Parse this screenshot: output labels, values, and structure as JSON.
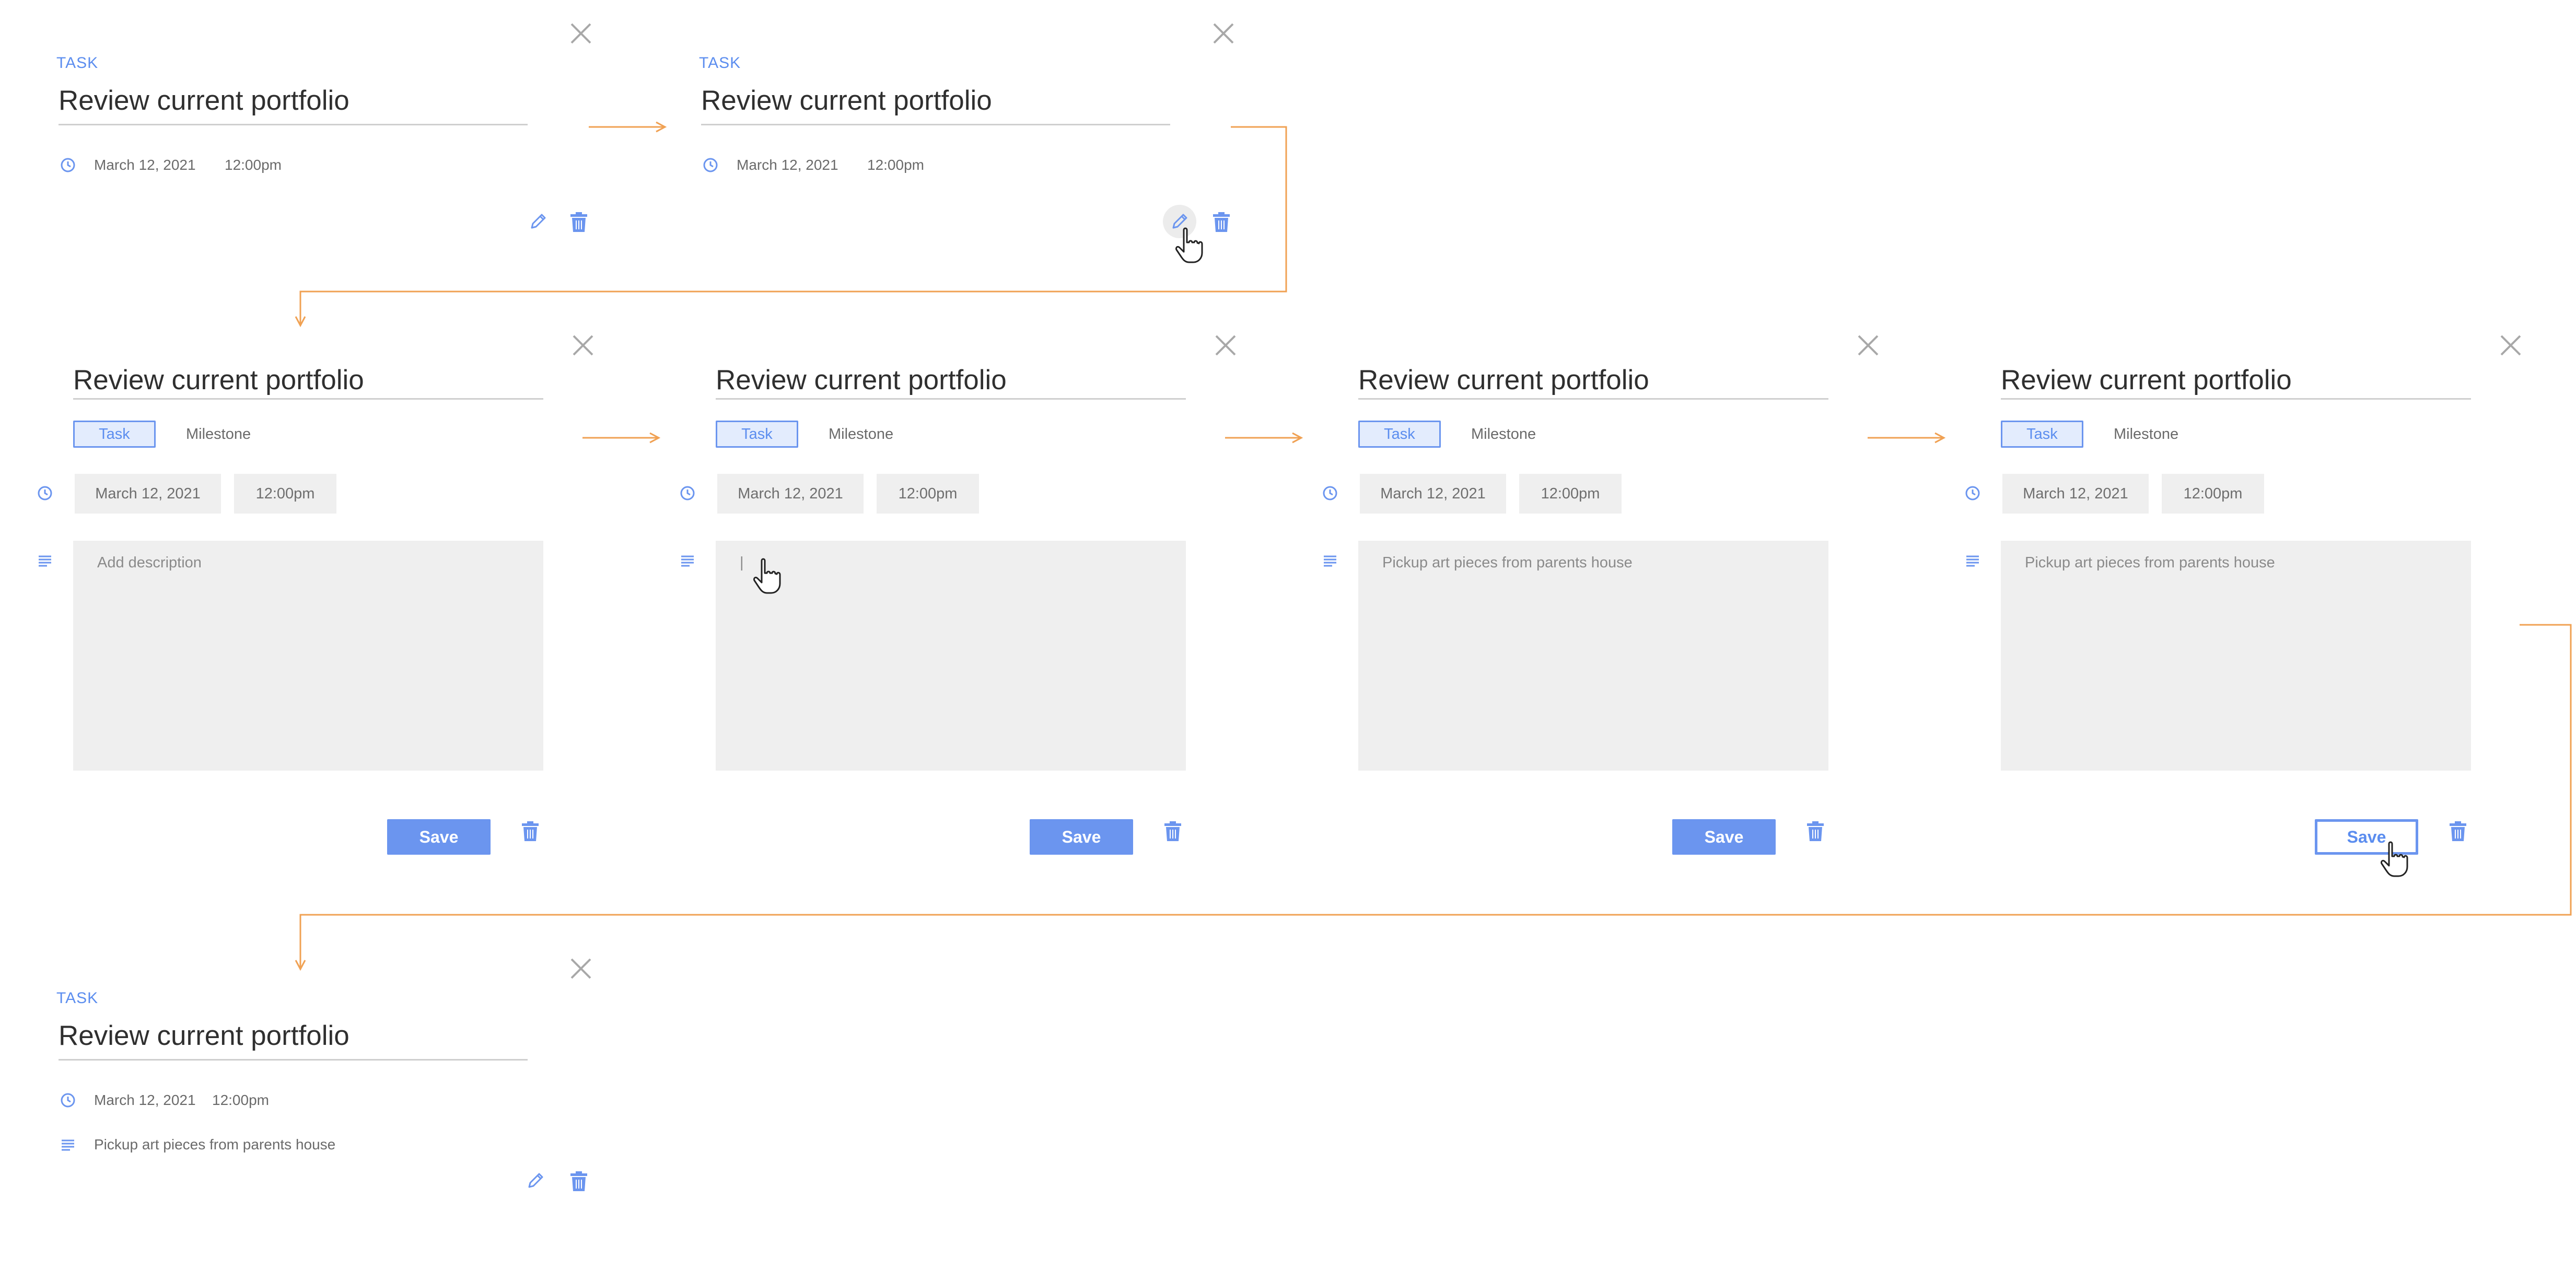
{
  "colors": {
    "accent": "#6b95ef",
    "arrow": "#f0a153",
    "field_bg": "#efefef",
    "close": "#a8a8a8"
  },
  "icons": {
    "close": "close-icon",
    "clock": "clock-icon",
    "description": "description-lines-icon",
    "edit": "pencil-icon",
    "delete": "trash-icon",
    "cursor": "hand-pointer-cursor-icon"
  },
  "panels": [
    {
      "kind": "TASK",
      "title": "Review current portfolio",
      "date": "March 12, 2021",
      "time": "12:00pm"
    },
    {
      "kind": "TASK",
      "title": "Review current portfolio",
      "date": "March 12, 2021",
      "time": "12:00pm"
    },
    {
      "title": "Review current portfolio",
      "type_task": "Task",
      "type_milestone": "Milestone",
      "date": "March 12, 2021",
      "time": "12:00pm",
      "description": "Add description",
      "save": "Save"
    },
    {
      "title": "Review current portfolio",
      "type_task": "Task",
      "type_milestone": "Milestone",
      "date": "March 12, 2021",
      "time": "12:00pm",
      "description": "|",
      "save": "Save"
    },
    {
      "title": "Review current portfolio",
      "type_task": "Task",
      "type_milestone": "Milestone",
      "date": "March 12, 2021",
      "time": "12:00pm",
      "description": "Pickup art pieces from parents house",
      "save": "Save"
    },
    {
      "title": "Review current portfolio",
      "type_task": "Task",
      "type_milestone": "Milestone",
      "date": "March 12, 2021",
      "time": "12:00pm",
      "description": "Pickup art pieces from parents house",
      "save": "Save"
    },
    {
      "kind": "TASK",
      "title": "Review current portfolio",
      "date": "March 12, 2021",
      "time": "12:00pm",
      "description": "Pickup art pieces from parents house"
    }
  ]
}
